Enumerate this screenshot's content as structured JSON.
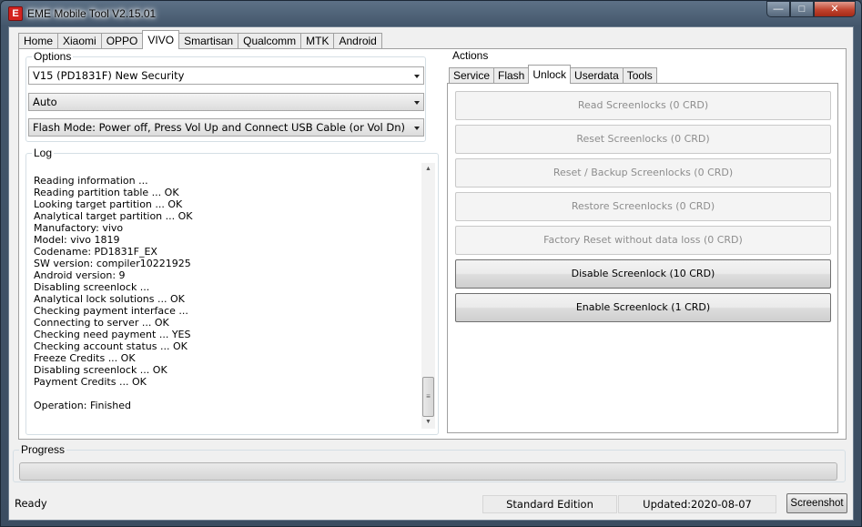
{
  "window": {
    "title": "EME Mobile Tool V2.15.01",
    "icon_letter": "E",
    "controls": {
      "minimize": "—",
      "maximize": "□",
      "close": "✕"
    }
  },
  "main_tabs": [
    "Home",
    "Xiaomi",
    "OPPO",
    "VIVO",
    "Smartisan",
    "Qualcomm",
    "MTK",
    "Android"
  ],
  "active_main_tab": "VIVO",
  "options": {
    "label": "Options",
    "model_select": "V15 (PD1831F) New Security",
    "mode_select": "Auto",
    "flash_mode_select": "Flash Mode: Power off, Press Vol Up and Connect USB Cable (or Vol Dn)"
  },
  "log": {
    "label": "Log",
    "lines": [
      "Reading information ...",
      "Reading partition table ... OK",
      "Looking target partition ... OK",
      "Analytical target partition ... OK",
      "Manufactory: vivo",
      "Model: vivo 1819",
      "Codename: PD1831F_EX",
      "SW version: compiler10221925",
      "Android version: 9",
      "Disabling screenlock ...",
      "Analytical lock solutions ... OK",
      "Checking payment interface ...",
      "Connecting to server ... OK",
      "Checking need payment ... YES",
      "Checking account status ... OK",
      "Freeze Credits ... OK",
      "Disabling screenlock ... OK",
      "Payment Credits ... OK",
      "",
      "Operation: Finished"
    ]
  },
  "actions": {
    "label": "Actions",
    "sub_tabs": [
      "Service",
      "Flash",
      "Unlock",
      "Userdata",
      "Tools"
    ],
    "active_sub_tab": "Unlock",
    "buttons": [
      {
        "label": "Read Screenlocks (0 CRD)",
        "enabled": false
      },
      {
        "label": "Reset Screenlocks (0 CRD)",
        "enabled": false
      },
      {
        "label": "Reset / Backup Screenlocks (0 CRD)",
        "enabled": false
      },
      {
        "label": "Restore Screenlocks (0 CRD)",
        "enabled": false
      },
      {
        "label": "Factory Reset without data loss (0 CRD)",
        "enabled": false
      },
      {
        "label": "Disable Screenlock (10 CRD)",
        "enabled": true
      },
      {
        "label": "Enable Screenlock (1 CRD)",
        "enabled": true
      }
    ]
  },
  "progress": {
    "label": "Progress",
    "value": 0
  },
  "status": {
    "text": "Ready",
    "edition": "Standard Edition",
    "updated": "Updated:2020-08-07",
    "screenshot_button": "Screenshot"
  },
  "colors": {
    "title_bar": "#4d6075",
    "close_button": "#c0432e",
    "panel_bg": "#f0f0f0"
  }
}
